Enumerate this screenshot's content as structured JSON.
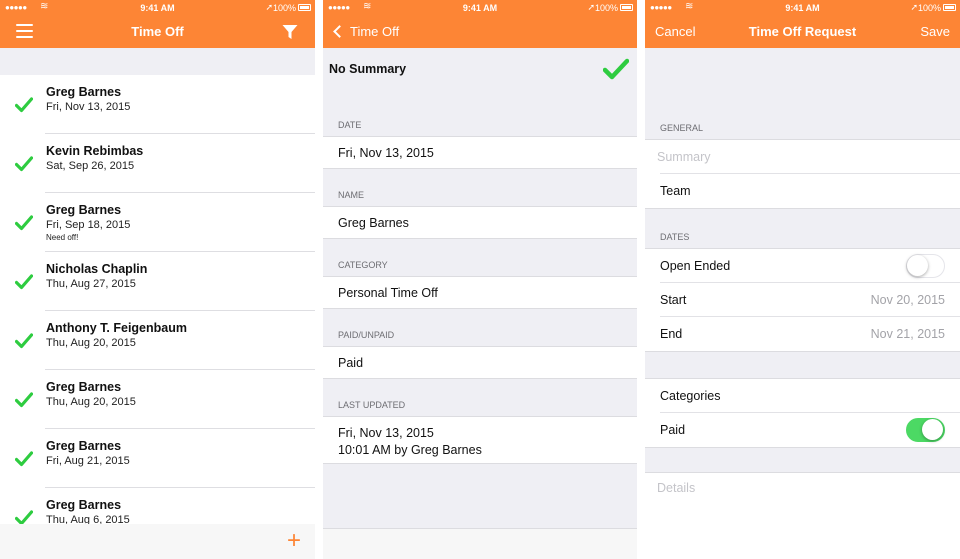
{
  "status": {
    "signal": "●●●●●",
    "time": "9:41 AM",
    "battery": "100%"
  },
  "colors": {
    "accent": "#fd8535",
    "check": "#2ecc40",
    "toggle_on": "#4cd964"
  },
  "screen1": {
    "nav_title": "Time Off",
    "icons": {
      "menu": "hamburger-icon",
      "filter": "filter-icon",
      "add": "plus-icon",
      "row": "checkmark-icon"
    },
    "add_label": "+",
    "items": [
      {
        "name": "Greg Barnes",
        "date": "Fri, Nov 13, 2015",
        "note": ""
      },
      {
        "name": "Kevin Rebimbas",
        "date": "Sat, Sep 26, 2015",
        "note": ""
      },
      {
        "name": "Greg Barnes",
        "date": "Fri, Sep 18, 2015",
        "note": "Need off!"
      },
      {
        "name": "Nicholas Chaplin",
        "date": "Thu, Aug 27, 2015",
        "note": ""
      },
      {
        "name": "Anthony T. Feigenbaum",
        "date": "Thu, Aug 20, 2015",
        "note": ""
      },
      {
        "name": "Greg Barnes",
        "date": "Thu, Aug 20, 2015",
        "note": ""
      },
      {
        "name": "Greg Barnes",
        "date": "Fri, Aug 21, 2015",
        "note": ""
      },
      {
        "name": "Greg Barnes",
        "date": "Thu, Aug 6, 2015",
        "note": ""
      }
    ]
  },
  "screen2": {
    "back_label": "Time Off",
    "summary": "No Summary",
    "sections": [
      {
        "header": "DATE",
        "value": "Fri, Nov 13, 2015"
      },
      {
        "header": "NAME",
        "value": "Greg Barnes"
      },
      {
        "header": "CATEGORY",
        "value": "Personal Time Off"
      },
      {
        "header": "PAID/UNPAID",
        "value": "Paid"
      }
    ],
    "last_updated": {
      "header": "LAST UPDATED",
      "line1": "Fri, Nov 13, 2015",
      "line2": "10:01 AM by Greg Barnes"
    }
  },
  "screen3": {
    "cancel_label": "Cancel",
    "title": "Time Off Request",
    "save_label": "Save",
    "general_header": "GENERAL",
    "summary_placeholder": "Summary",
    "team_label": "Team",
    "dates_header": "DATES",
    "open_ended_label": "Open Ended",
    "open_ended_on": false,
    "start_label": "Start",
    "start_value": "Nov 20, 2015",
    "end_label": "End",
    "end_value": "Nov 21, 2015",
    "categories_label": "Categories",
    "paid_label": "Paid",
    "paid_on": true,
    "details_placeholder": "Details"
  }
}
